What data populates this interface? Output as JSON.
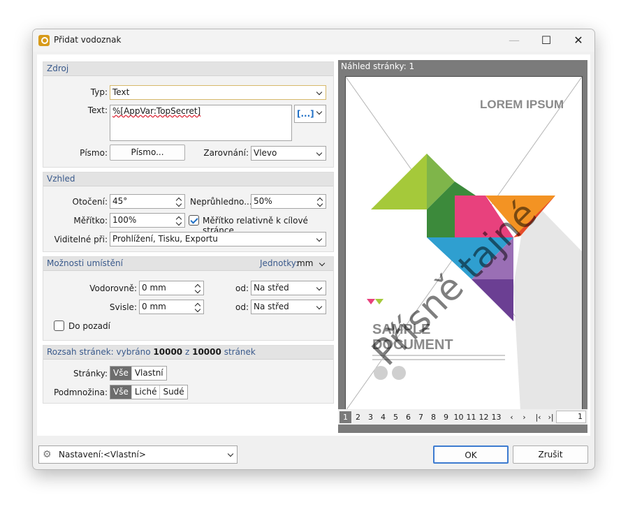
{
  "window": {
    "title": "Přidat vodoznak",
    "controls": {
      "minimize": "—",
      "maximize": "☐",
      "close": "✕"
    }
  },
  "source": {
    "header": "Zdroj",
    "type_label": "Typ:",
    "type_value": "Text",
    "text_label": "Text:",
    "text_value": "%[AppVar:TopSecret]",
    "insert_button": "[...]",
    "font_label": "Písmo:",
    "font_button": "Písmo...",
    "align_label": "Zarovnání:",
    "align_value": "Vlevo"
  },
  "appearance": {
    "header": "Vzhled",
    "rotation_label": "Otočení:",
    "rotation_value": "45°",
    "opacity_label": "Neprůhledno...",
    "opacity_value": "50%",
    "scale_label": "Měřítko:",
    "scale_value": "100%",
    "relative_scale_label": "Měřítko relativně k cílové stránce",
    "relative_scale_checked": true,
    "visible_label": "Viditelné při:",
    "visible_value": "Prohlížení, Tisku, Exportu"
  },
  "placement": {
    "header": "Možnosti umístění",
    "units_label": "Jednotky:",
    "units_value": "mm",
    "horizontal_label": "Vodorovně:",
    "horizontal_value": "0 mm",
    "h_from_label": "od:",
    "h_from_value": "Na střed",
    "vertical_label": "Svisle:",
    "vertical_value": "0 mm",
    "v_from_label": "od:",
    "v_from_value": "Na střed",
    "background_label": "Do pozadí",
    "background_checked": false
  },
  "range": {
    "header_prefix": "Rozsah stránek: vybráno",
    "header_selected": "10000",
    "header_mid": "z",
    "header_total": "10000",
    "header_suffix": "stránek",
    "pages_label": "Stránky:",
    "pages_options": [
      "Vše",
      "Vlastní"
    ],
    "subset_label": "Podmnožina:",
    "subset_options": [
      "Vše",
      "Liché",
      "Sudé"
    ]
  },
  "preview": {
    "header": "Náhled stránky: 1",
    "watermark_text": "Přísně tajné",
    "doc_title": "LOREM IPSUM",
    "doc_sample_line1": "SAMPLE",
    "doc_sample_line2": "DOCUMENT",
    "page_tabs": [
      "1",
      "2",
      "3",
      "4",
      "5",
      "6",
      "7",
      "8",
      "9",
      "10",
      "11",
      "12",
      "13"
    ],
    "current_page": "1",
    "colors": {
      "lime": "#a5c93a",
      "green": "#5c9a3a",
      "pink": "#e8417d",
      "orange": "#f39323",
      "red": "#e64b2a",
      "blue": "#2f9fd0",
      "purple": "#6b3f93",
      "gray": "#dcdcdc"
    }
  },
  "footer": {
    "settings_label": "Nastavení:",
    "settings_value": "<Vlastní>",
    "ok": "OK",
    "cancel": "Zrušit"
  }
}
